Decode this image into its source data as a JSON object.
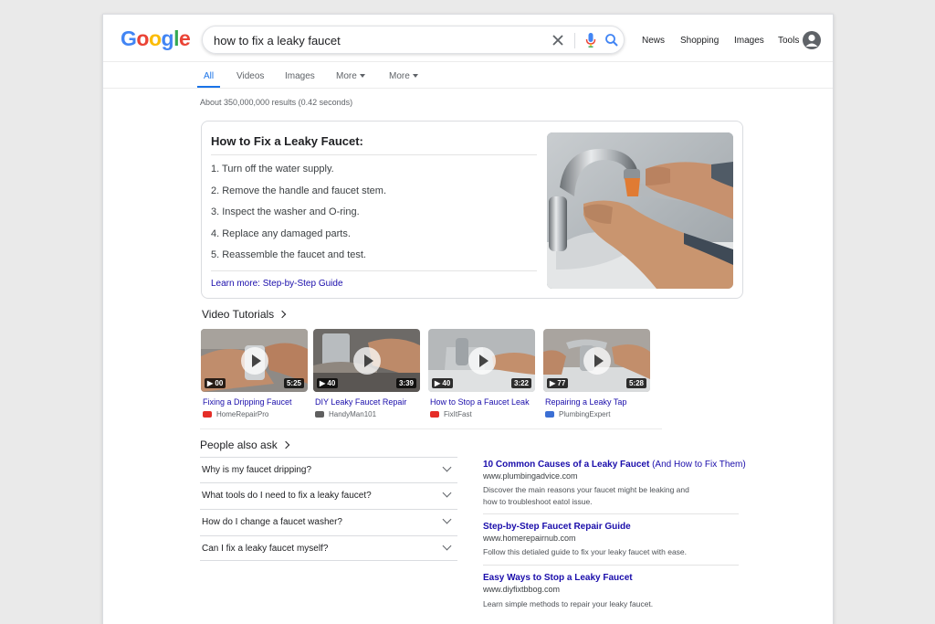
{
  "header": {
    "logo": "Google",
    "search_query": "how to fix a leaky faucet",
    "nav": [
      "News",
      "Shopping",
      "Images",
      "Tools"
    ]
  },
  "tabs": [
    "All",
    "Videos",
    "Images",
    "More",
    "More"
  ],
  "stats": "About 350,000,000 results (0.42 seconds)",
  "snippet": {
    "title": "How to Fix a Leaky Faucet:",
    "steps": [
      "1. Turn off the water supply.",
      "2. Remove the handle and faucet stem.",
      "3. Inspect the washer and O-ring.",
      "4. Replace any damaged parts.",
      "5. Reassemble the faucet and test."
    ],
    "learn_more": "Learn more: Step-by-Step Guide"
  },
  "video_heading": "Video Tutorials",
  "videos": [
    {
      "title": "Fixing a Dripping Faucet",
      "source": "HomeRepairPro",
      "badge": "00",
      "duration": "5:25"
    },
    {
      "title": "DIY Leaky Faucet Repair",
      "source": "HandyMan101",
      "badge": "40",
      "duration": "3:39"
    },
    {
      "title": "How to Stop a Faucet Leak",
      "source": "FixItFast",
      "badge": "40",
      "duration": "3:22"
    },
    {
      "title": "Repairing a Leaky Tap",
      "source": "PlumbingExpert",
      "badge": "77",
      "duration": "5:28"
    }
  ],
  "paa": {
    "heading": "People also ask",
    "questions": [
      "Why is my faucet dripping?",
      "What tools do I need to fix a leaky faucet?",
      "How do I change a faucet washer?",
      "Can I fix a leaky faucet myself?"
    ]
  },
  "results": [
    {
      "title": "10 Common Causes of a Leaky Faucet",
      "title_rest": "(And How to Fix Them)",
      "url": "www.plumbingadvice.com",
      "desc": "Discover the main reasons your faucet might be leaking and how to troubleshoot eatol issue."
    },
    {
      "title": "Step-by-Step Faucet Repair Guide",
      "title_rest": "",
      "url": "www.homerepairnub.com",
      "desc": "Follow this detialed guide to fix your leaky faucet with ease."
    },
    {
      "title": "Easy Ways to Stop a Leaky Faucet",
      "title_rest": "",
      "url": "www.diyfixtbbog.com",
      "desc": "Learn simple methods to repair your leaky faucet."
    }
  ],
  "colors": {
    "link": "#1a0dab",
    "accent": "#1a73e8",
    "youtube_red": "#e52d27"
  }
}
